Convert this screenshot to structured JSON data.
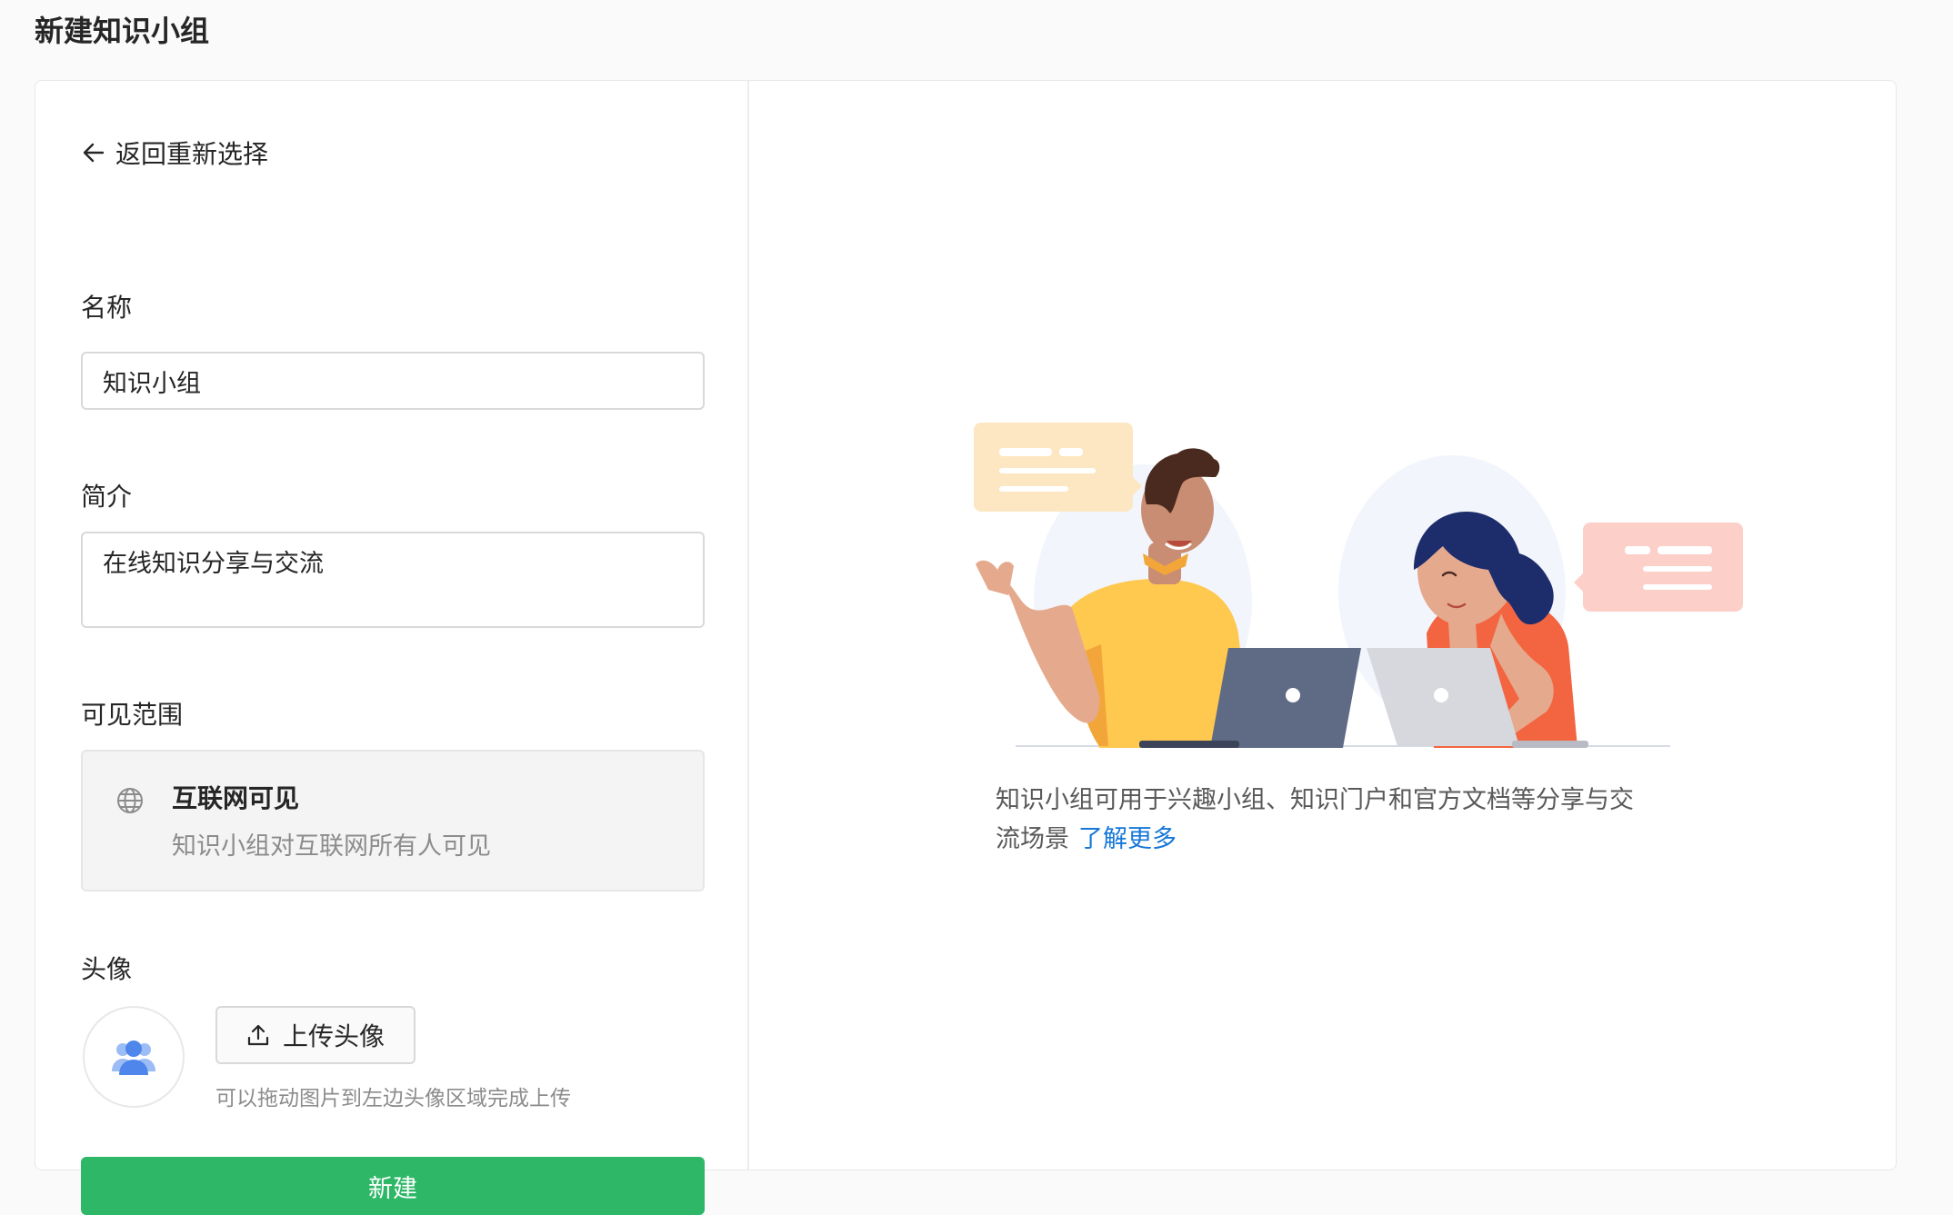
{
  "page": {
    "title": "新建知识小组"
  },
  "form": {
    "back_label": "返回重新选择",
    "name_label": "名称",
    "name_value": "知识小组",
    "intro_label": "简介",
    "intro_value": "在线知识分享与交流",
    "visibility_label": "可见范围",
    "visibility": {
      "title": "互联网可见",
      "description": "知识小组对互联网所有人可见",
      "icon": "globe-icon"
    },
    "avatar_label": "头像",
    "upload_label": "上传头像",
    "upload_hint": "可以拖动图片到左边头像区域完成上传",
    "submit_label": "新建"
  },
  "info": {
    "text": "知识小组可用于兴趣小组、知识门户和官方文档等分享与交流场景",
    "link_label": "了解更多"
  },
  "colors": {
    "primary_green": "#2eb767",
    "link_blue": "#1677d8",
    "avatar_blue": "#4f86ec"
  }
}
